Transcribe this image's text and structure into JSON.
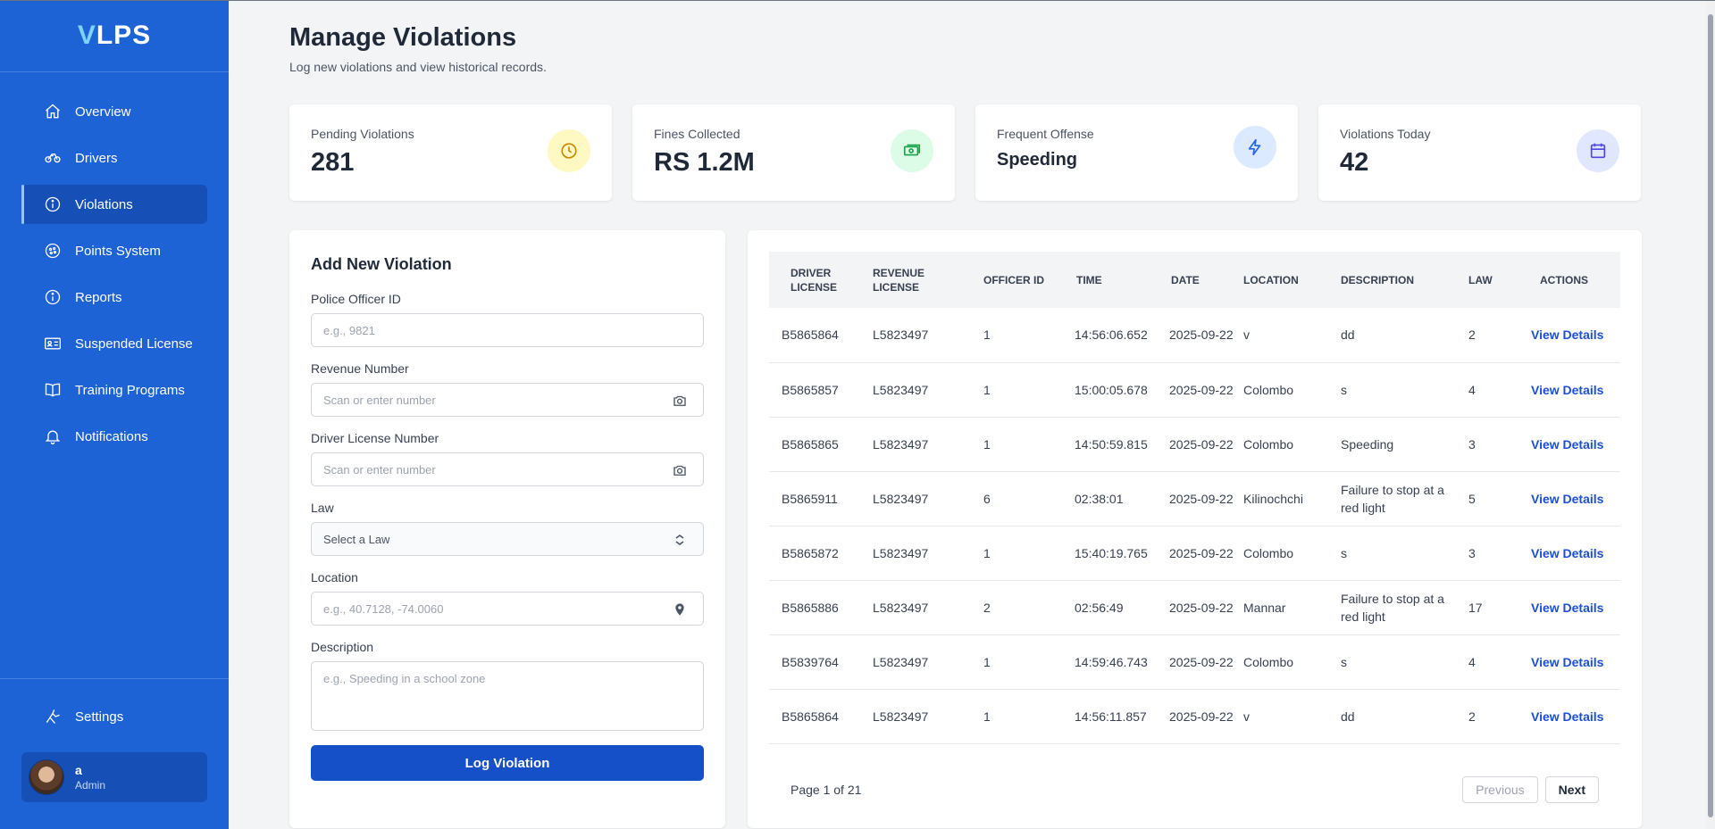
{
  "app": {
    "logo_v": "V",
    "logo_rest": "LPS"
  },
  "sidebar": {
    "items": [
      {
        "label": "Overview",
        "icon": "home-icon"
      },
      {
        "label": "Drivers",
        "icon": "drivers-icon"
      },
      {
        "label": "Violations",
        "icon": "info-icon",
        "active": true
      },
      {
        "label": "Points System",
        "icon": "points-icon"
      },
      {
        "label": "Reports",
        "icon": "info-icon"
      },
      {
        "label": "Suspended License",
        "icon": "license-card-icon"
      },
      {
        "label": "Training Programs",
        "icon": "book-icon"
      },
      {
        "label": "Notifications",
        "icon": "bell-icon"
      }
    ],
    "settings_label": "Settings",
    "user": {
      "name": "a",
      "role": "Admin"
    }
  },
  "header": {
    "title": "Manage Violations",
    "subtitle": "Log new violations and view historical records."
  },
  "stats": [
    {
      "label": "Pending Violations",
      "value": "281",
      "icon": "clock-icon",
      "color": "#ca8a04",
      "bg": "#fef9c3"
    },
    {
      "label": "Fines Collected",
      "value": "RS 1.2M",
      "icon": "cash-icon",
      "color": "#16a34a",
      "bg": "#dcfce7"
    },
    {
      "label": "Frequent Offense",
      "value": "Speeding",
      "icon": "lightning-icon",
      "color": "#2563eb",
      "bg": "#dbeafe"
    },
    {
      "label": "Violations Today",
      "value": "42",
      "icon": "calendar-icon",
      "color": "#4f46e5",
      "bg": "#e0e7ff"
    }
  ],
  "form": {
    "title": "Add New Violation",
    "officer_label": "Police Officer ID",
    "officer_placeholder": "e.g., 9821",
    "revenue_label": "Revenue Number",
    "revenue_placeholder": "Scan or enter number",
    "license_label": "Driver License Number",
    "license_placeholder": "Scan or enter number",
    "law_label": "Law",
    "law_value": "Select a Law",
    "location_label": "Location",
    "location_placeholder": "e.g., 40.7128, -74.0060",
    "description_label": "Description",
    "description_placeholder": "e.g., Speeding in a school zone",
    "submit_label": "Log Violation"
  },
  "table": {
    "columns": [
      "Driver License",
      "Revenue License",
      "Officer ID",
      "Time",
      "Date",
      "Location",
      "Description",
      "Law",
      "Actions"
    ],
    "rows": [
      [
        "B5865864",
        "L5823497",
        "1",
        "14:56:06.652",
        "2025-09-22",
        "v",
        "dd",
        "2",
        "View Details"
      ],
      [
        "B5865857",
        "L5823497",
        "1",
        "15:00:05.678",
        "2025-09-22",
        "Colombo",
        "s",
        "4",
        "View Details"
      ],
      [
        "B5865865",
        "L5823497",
        "1",
        "14:50:59.815",
        "2025-09-22",
        "Colombo",
        "Speeding",
        "3",
        "View Details"
      ],
      [
        "B5865911",
        "L5823497",
        "6",
        "02:38:01",
        "2025-09-22",
        "Kilinochchi",
        "Failure to stop at a red light",
        "5",
        "View Details"
      ],
      [
        "B5865872",
        "L5823497",
        "1",
        "15:40:19.765",
        "2025-09-22",
        "Colombo",
        "s",
        "3",
        "View Details"
      ],
      [
        "B5865886",
        "L5823497",
        "2",
        "02:56:49",
        "2025-09-22",
        "Mannar",
        "Failure to stop at a red light",
        "17",
        "View Details"
      ],
      [
        "B5839764",
        "L5823497",
        "1",
        "14:59:46.743",
        "2025-09-22",
        "Colombo",
        "s",
        "4",
        "View Details"
      ],
      [
        "B5865864",
        "L5823497",
        "1",
        "14:56:11.857",
        "2025-09-22",
        "v",
        "dd",
        "2",
        "View Details"
      ]
    ]
  },
  "pagination": {
    "text": "Page 1 of 21",
    "previous": "Previous",
    "next": "Next"
  }
}
